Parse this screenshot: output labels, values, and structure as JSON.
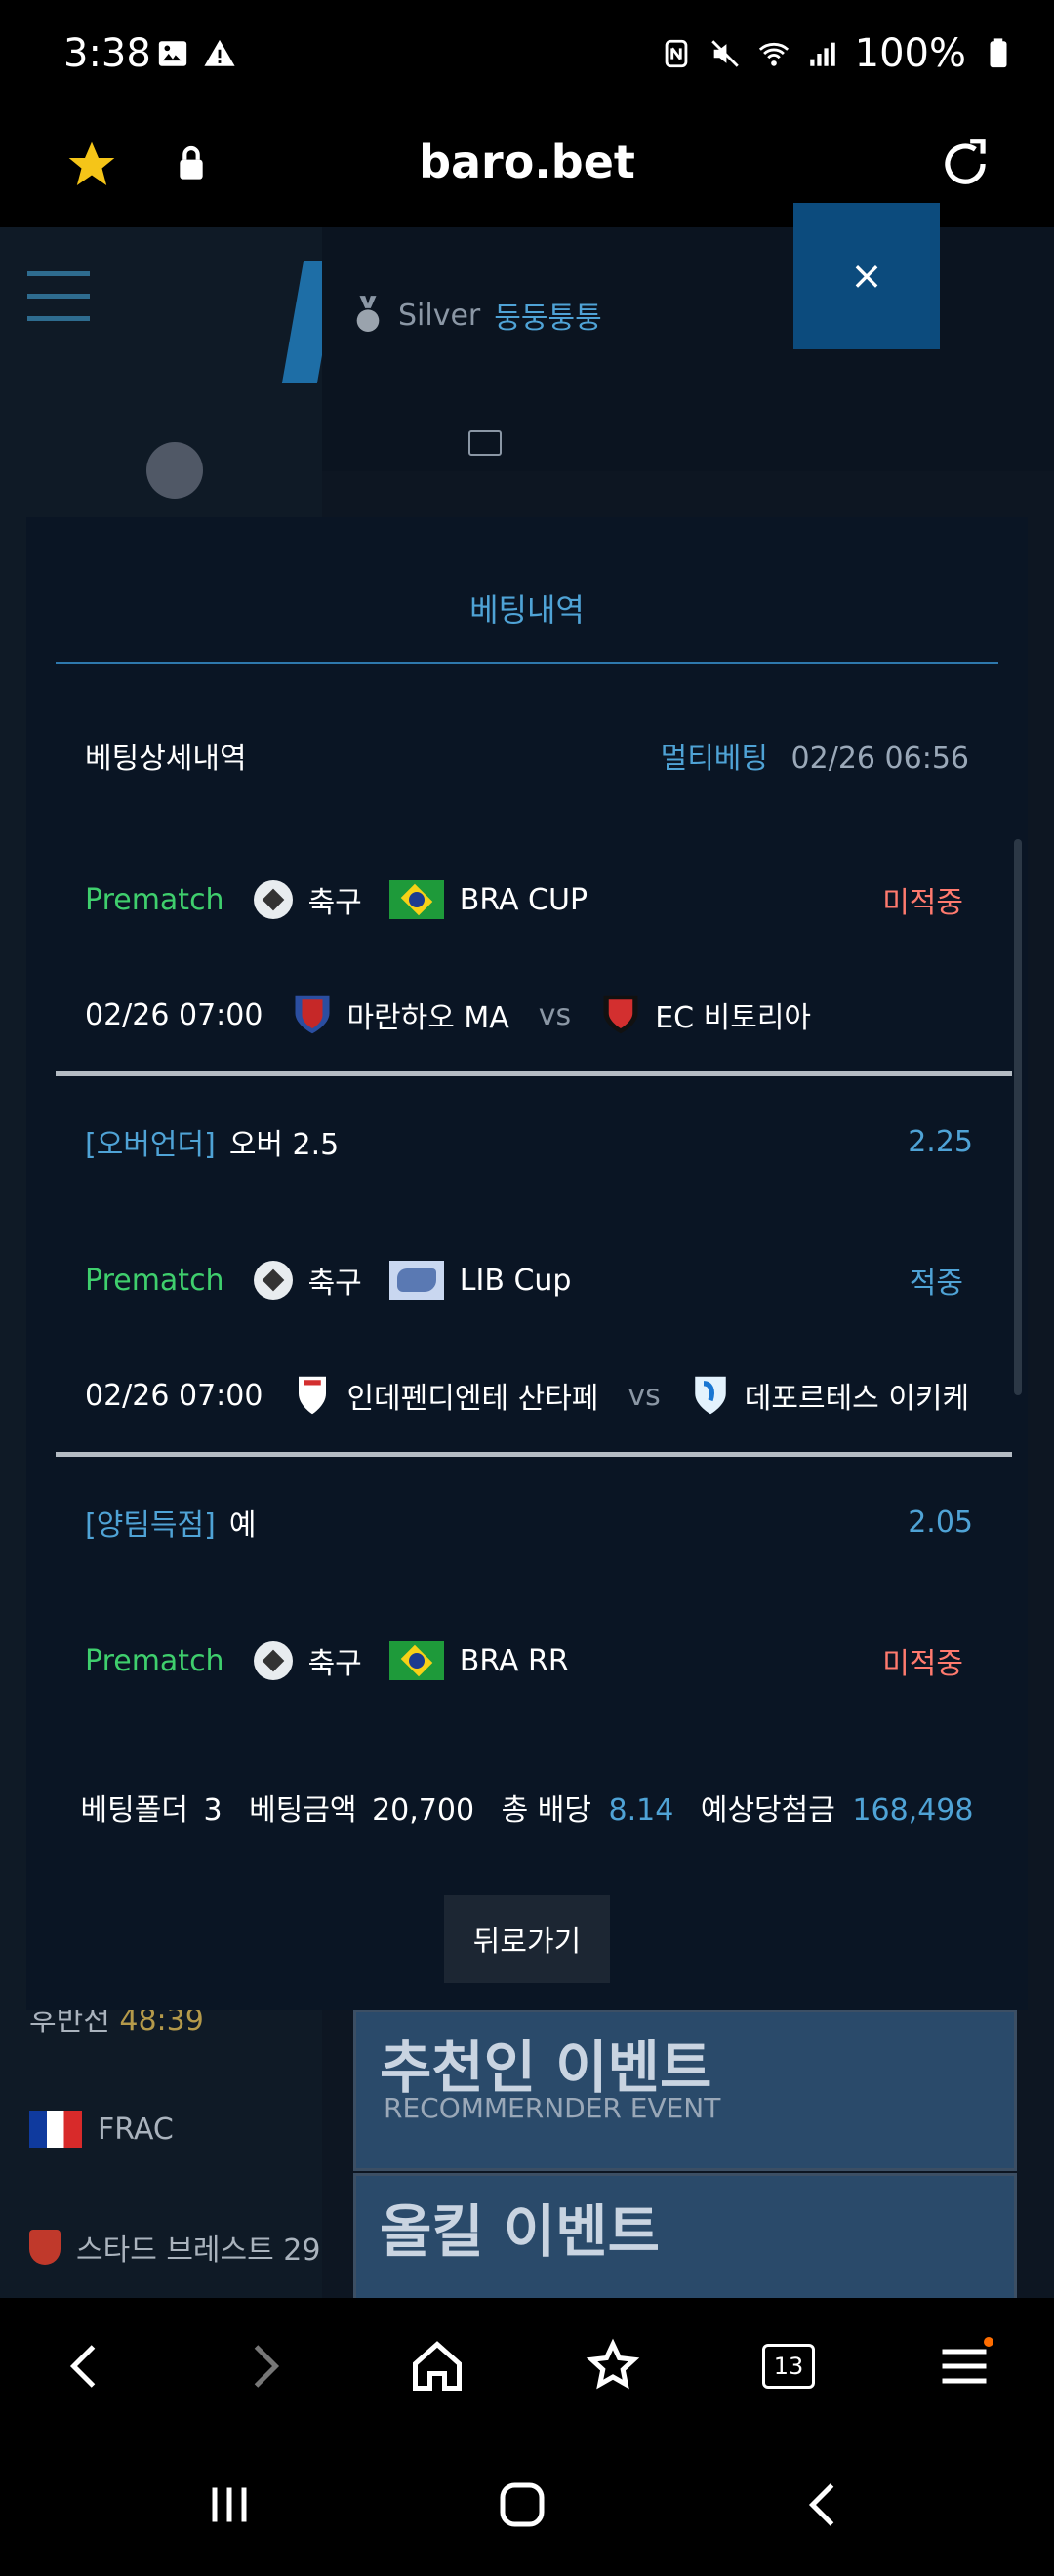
{
  "status": {
    "time": "3:38",
    "battery": "100%"
  },
  "browser": {
    "url": "baro.bet",
    "tab_count": "13"
  },
  "background_page": {
    "rank": "Silver",
    "username": "둥둥퉁퉁",
    "rows": [
      {
        "text": "후반전",
        "extra": "48:39"
      },
      {
        "text": "FRAC"
      },
      {
        "text": "스타드 브레스트 29"
      }
    ],
    "banners": [
      {
        "title": "추천인 이벤트",
        "subtitle": "RECOMMERNDER EVENT"
      },
      {
        "title": "올킬 이벤트",
        "subtitle": ""
      }
    ]
  },
  "modal": {
    "close_label": "×",
    "tab_label": "베팅내역",
    "detail_label": "베팅상세내역",
    "bet_type": "멀티베팅",
    "bet_time": "02/26 06:56",
    "bets": [
      {
        "market": "Prematch",
        "sport": "축구",
        "league": "BRA CUP",
        "status": "미적중",
        "match_time": "02/26 07:00",
        "home": "마란하오 MA",
        "vs": "vs",
        "away": "EC 비토리아",
        "pick_type": "[오버언더]",
        "pick": "오버 2.5",
        "odds": "2.25"
      },
      {
        "market": "Prematch",
        "sport": "축구",
        "league": "LIB Cup",
        "status": "적중",
        "match_time": "02/26 07:00",
        "home": "인데펜디엔테 산타페",
        "vs": "vs",
        "away": "데포르테스 이키케",
        "pick_type": "[양팀득점]",
        "pick": "예",
        "odds": "2.05"
      },
      {
        "market": "Prematch",
        "sport": "축구",
        "league": "BRA RR",
        "status": "미적중"
      }
    ],
    "summary": {
      "folder_label": "베팅폴더",
      "folder": "3",
      "amount_label": "베팅금액",
      "amount": "20,700",
      "odds_label": "총 배당",
      "odds": "8.14",
      "payout_label": "예상당첨금",
      "payout": "168,498"
    },
    "back_label": "뒤로가기"
  },
  "colors": {
    "accent_blue": "#4fa3d6",
    "win_green": "#3fcf6d",
    "lose_red": "#ff7a6e",
    "modal_bg": "#0a1524"
  }
}
